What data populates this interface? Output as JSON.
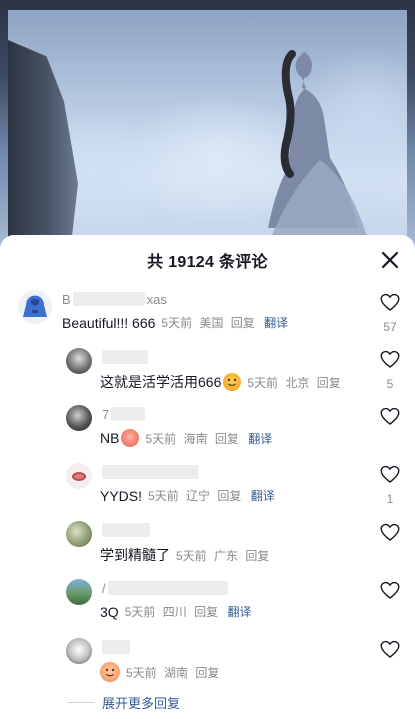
{
  "header": {
    "title": "共 19124 条评论"
  },
  "comments": [
    {
      "name_prefix": "B",
      "name_suffix": "xas",
      "text": "Beautiful!!! 666",
      "time": "5天前",
      "location": "美国",
      "reply": "回复",
      "translate": "翻译",
      "likes": "57"
    },
    {
      "text": "这就是活学活用666",
      "time": "5天前",
      "location": "北京",
      "reply": "回复",
      "likes": "5"
    },
    {
      "name_prefix": "7",
      "text": "NB",
      "time": "5天前",
      "location": "海南",
      "reply": "回复",
      "translate": "翻译"
    },
    {
      "text": "YYDS!",
      "time": "5天前",
      "location": "辽宁",
      "reply": "回复",
      "translate": "翻译",
      "likes": "1"
    },
    {
      "text": "学到精髓了",
      "time": "5天前",
      "location": "广东",
      "reply": "回复"
    },
    {
      "name_prefix": "/",
      "text": "3Q",
      "time": "5天前",
      "location": "四川",
      "reply": "回复",
      "translate": "翻译"
    },
    {
      "time": "5天前",
      "location": "湖南",
      "reply": "回复"
    }
  ],
  "expand": {
    "label": "展开更多回复"
  },
  "icons": [
    "close-icon",
    "heart-outline-icon",
    "hoodie-avatar-icon",
    "emoji-icon"
  ],
  "colors": {
    "text": "#161823",
    "meta": "#8a8b91",
    "link": "#345a94",
    "sheet": "#ffffff"
  }
}
